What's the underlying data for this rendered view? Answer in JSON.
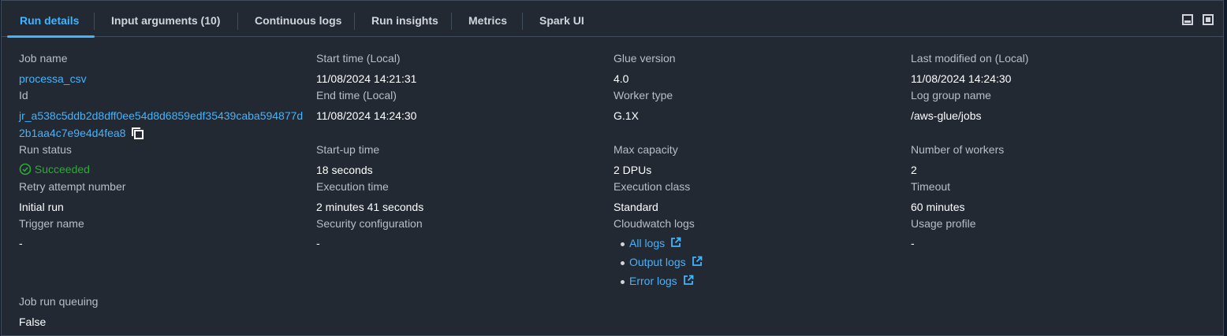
{
  "tabs": [
    {
      "label": "Run details",
      "active": true
    },
    {
      "label": "Input arguments (10)",
      "active": false
    },
    {
      "label": "Continuous logs",
      "active": false
    },
    {
      "label": "Run insights",
      "active": false
    },
    {
      "label": "Metrics",
      "active": false
    },
    {
      "label": "Spark UI",
      "active": false
    }
  ],
  "window_controls": [
    "minimize-panel-icon",
    "maximize-panel-icon"
  ],
  "colors": {
    "background": "#222933",
    "accent": "#42b4ff",
    "success": "#29ad32",
    "label": "#b6bec9",
    "value": "#ffffff"
  },
  "fields": {
    "job_name": {
      "label": "Job name",
      "value": "processa_csv"
    },
    "id": {
      "label": "Id",
      "value_line1": "jr_a538c5ddb2d8dff0ee54d8d6859edf35439caba594877d",
      "value_line2": "2b1aa4c7e9e4d4fea8"
    },
    "run_status": {
      "label": "Run status",
      "value": "Succeeded"
    },
    "retry_attempt": {
      "label": "Retry attempt number",
      "value": "Initial run"
    },
    "trigger_name": {
      "label": "Trigger name",
      "value": "-"
    },
    "job_run_queuing": {
      "label": "Job run queuing",
      "value": "False"
    },
    "start_time": {
      "label": "Start time (Local)",
      "value": "11/08/2024 14:21:31"
    },
    "end_time": {
      "label": "End time (Local)",
      "value": "11/08/2024 14:24:30"
    },
    "startup_time": {
      "label": "Start-up time",
      "value": "18 seconds"
    },
    "execution_time": {
      "label": "Execution time",
      "value": "2 minutes 41 seconds"
    },
    "security_configuration": {
      "label": "Security configuration",
      "value": "-"
    },
    "glue_version": {
      "label": "Glue version",
      "value": "4.0"
    },
    "worker_type": {
      "label": "Worker type",
      "value": "G.1X"
    },
    "max_capacity": {
      "label": "Max capacity",
      "value": "2 DPUs"
    },
    "execution_class": {
      "label": "Execution class",
      "value": "Standard"
    },
    "cloudwatch_logs": {
      "label": "Cloudwatch logs",
      "links": [
        "All logs",
        "Output logs",
        "Error logs"
      ]
    },
    "last_modified": {
      "label": "Last modified on (Local)",
      "value": "11/08/2024 14:24:30"
    },
    "log_group_name": {
      "label": "Log group name",
      "value": "/aws-glue/jobs"
    },
    "number_of_workers": {
      "label": "Number of workers",
      "value": "2"
    },
    "timeout": {
      "label": "Timeout",
      "value": "60 minutes"
    },
    "usage_profile": {
      "label": "Usage profile",
      "value": "-"
    }
  }
}
